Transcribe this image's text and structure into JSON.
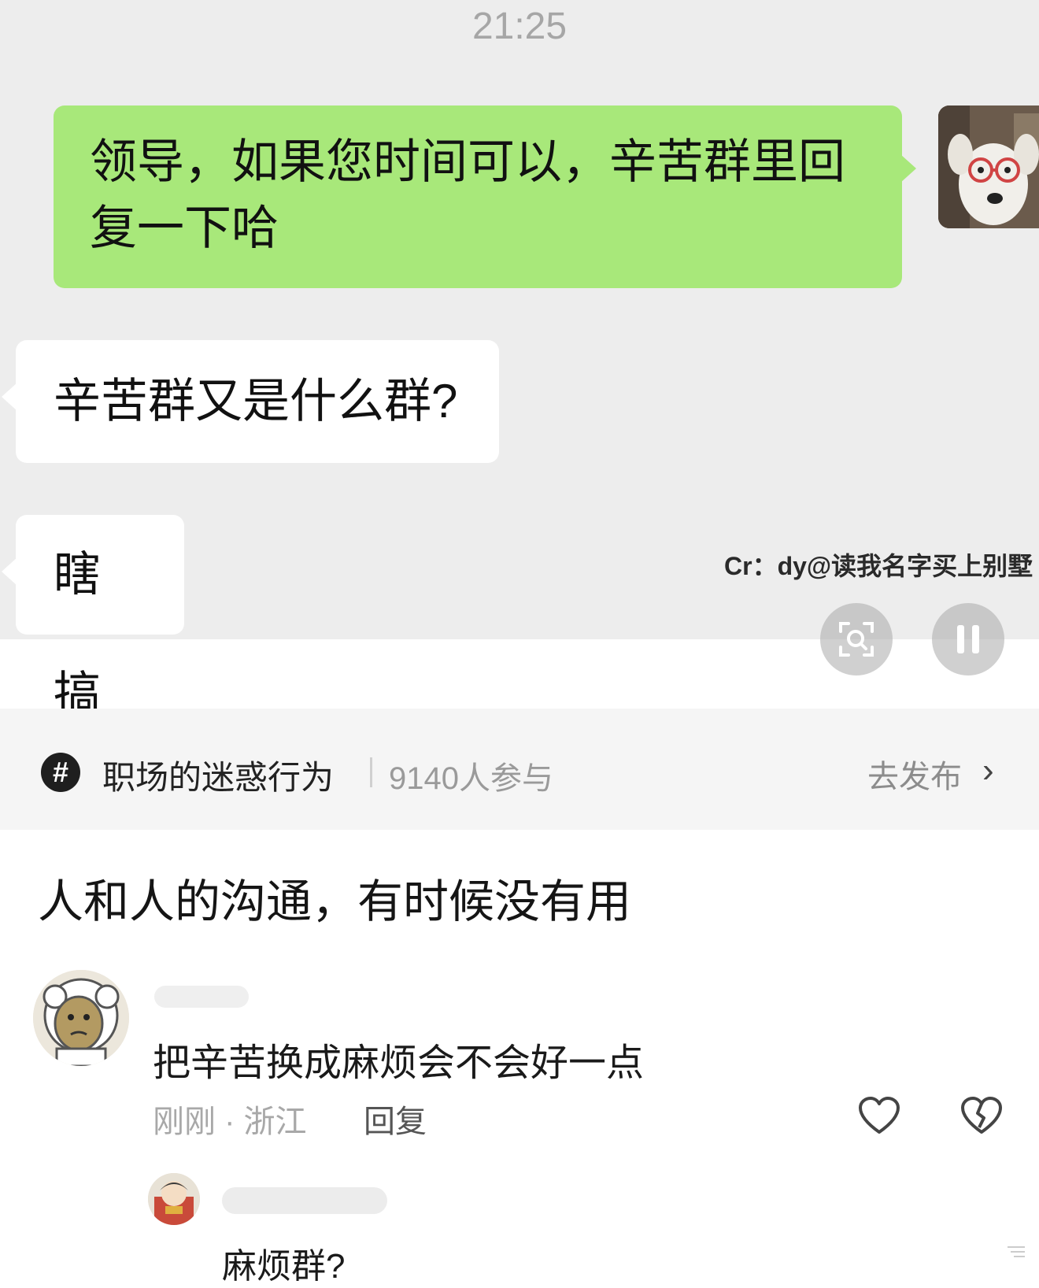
{
  "chat": {
    "time": "21:25",
    "outgoing_message": "领导，如果您时间可以，辛苦群里回复一下哈",
    "incoming_messages": [
      "辛苦群又是什么群?",
      "瞎搞"
    ],
    "watermark": "Cr：dy@读我名字买上别墅",
    "controls": {
      "scan_icon": "scan-icon",
      "pause_icon": "pause-icon"
    },
    "colors": {
      "background": "#ededed",
      "outgoing_bubble": "#a8e87a",
      "incoming_bubble": "#ffffff"
    }
  },
  "topic": {
    "icon_symbol": "#",
    "name": "职场的迷惑行为",
    "participants": "9140人参与",
    "action": "去发布",
    "chevron": "›"
  },
  "post": {
    "text": "人和人的沟通，有时候没有用"
  },
  "comments": [
    {
      "text": "把辛苦换成麻烦会不会好一点",
      "meta": "刚刚 · 浙江",
      "reply_label": "回复",
      "like_icon": "heart-outline-icon",
      "dislike_icon": "broken-heart-icon"
    }
  ],
  "replies": [
    {
      "text": "麻烦群?"
    }
  ]
}
